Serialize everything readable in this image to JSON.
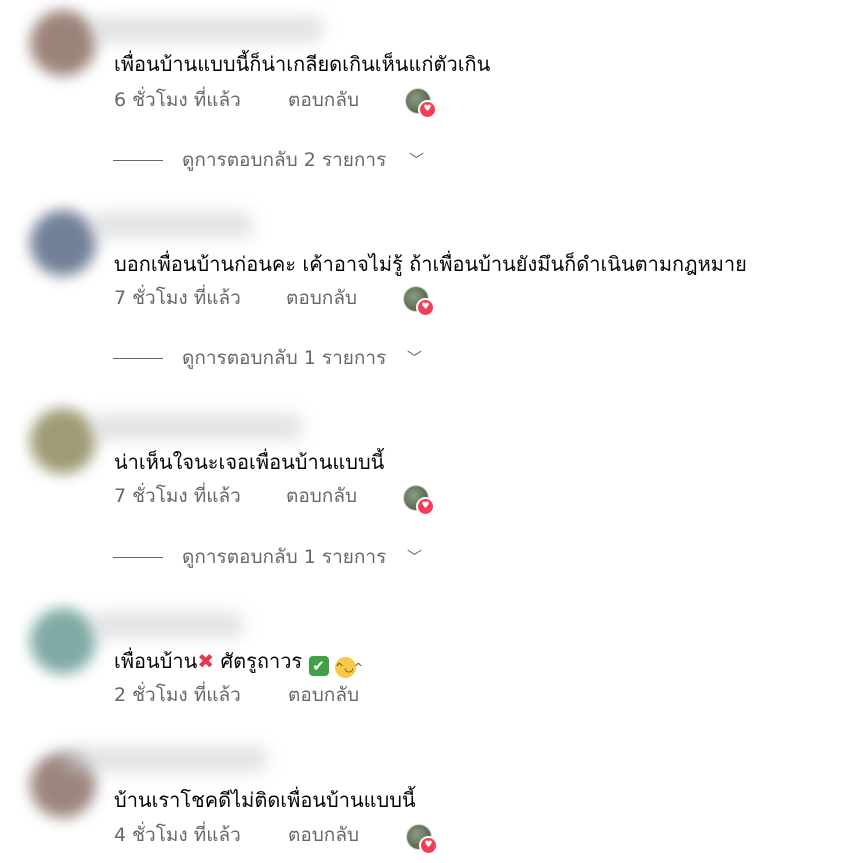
{
  "comments": [
    {
      "text": "เพื่อนบ้านแบบนี้ก็น่าเกลียดเกินเห็นแก่ตัวเกิน",
      "time": "6 ชั่วโมง ที่แล้ว",
      "reply_label": "ตอบกลับ",
      "view_replies": "ดูการตอบกลับ 2 รายการ",
      "avatar_color": "#8a6e62"
    },
    {
      "text": "บอกเพื่อนบ้านก่อนคะ เค้าอาจไม่รู้ ถ้าเพื่อนบ้านยังมึนก็ดำเนินตามกฎหมาย",
      "time": "7 ชั่วโมง ที่แล้ว",
      "reply_label": "ตอบกลับ",
      "view_replies": "ดูการตอบกลับ 1 รายการ",
      "avatar_color": "#5a6a86"
    },
    {
      "text": "น่าเห็นใจนะเจอเพื่อนบ้านแบบนี้",
      "time": "7 ชั่วโมง ที่แล้ว",
      "reply_label": "ตอบกลับ",
      "view_replies": "ดูการตอบกลับ 1 รายการ",
      "avatar_color": "#8f8a5e"
    },
    {
      "text_part1": "เพื่อนบ้าน",
      "text_part2": "ศัตรูถาวร",
      "time": "2 ชั่วโมง ที่แล้ว",
      "reply_label": "ตอบกลับ",
      "avatar_color": "#6a9c96"
    },
    {
      "text": "บ้านเราโชคดีไม่ติดเพื่อนบ้านแบบนี้",
      "time": "4 ชั่วโมง ที่แล้ว",
      "reply_label": "ตอบกลับ",
      "avatar_color": "#8a7268"
    }
  ],
  "icons": {
    "heart": "♥",
    "chevron": "﹀",
    "cross": "✖",
    "check": "✔",
    "laugh": "^◡^"
  },
  "colors": {
    "text": "#050505",
    "meta": "#65676b",
    "heart": "#f33e58"
  }
}
